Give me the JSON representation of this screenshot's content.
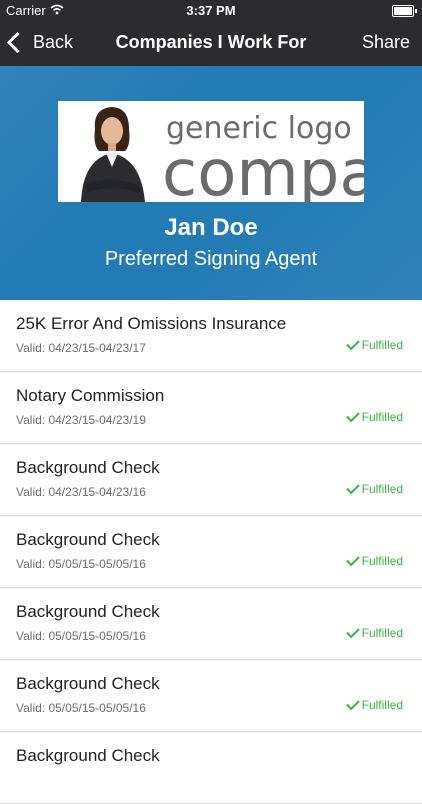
{
  "status_bar": {
    "carrier": "Carrier",
    "time": "3:37 PM"
  },
  "nav": {
    "back_label": "Back",
    "title": "Companies I Work For",
    "share_label": "Share"
  },
  "profile": {
    "logo_text_line1": "generic logo",
    "logo_text_line2": "company",
    "name": "Jan Doe",
    "role": "Preferred Signing Agent"
  },
  "colors": {
    "nav_bg": "#2c2c2e",
    "hero_bg": "#237bb5",
    "fulfilled": "#3cae49"
  },
  "credentials": [
    {
      "title": "25K Error And Omissions Insurance",
      "valid": "Valid: 04/23/15-04/23/17",
      "status": "Fulfilled"
    },
    {
      "title": "Notary Commission",
      "valid": "Valid: 04/23/15-04/23/19",
      "status": "Fulfilled"
    },
    {
      "title": "Background Check",
      "valid": "Valid: 04/23/15-04/23/16",
      "status": "Fulfilled"
    },
    {
      "title": "Background Check",
      "valid": "Valid: 05/05/15-05/05/16",
      "status": "Fulfilled"
    },
    {
      "title": "Background Check",
      "valid": "Valid: 05/05/15-05/05/16",
      "status": "Fulfilled"
    },
    {
      "title": "Background Check",
      "valid": "Valid: 05/05/15-05/05/16",
      "status": "Fulfilled"
    },
    {
      "title": "Background Check",
      "valid": "",
      "status": ""
    }
  ]
}
